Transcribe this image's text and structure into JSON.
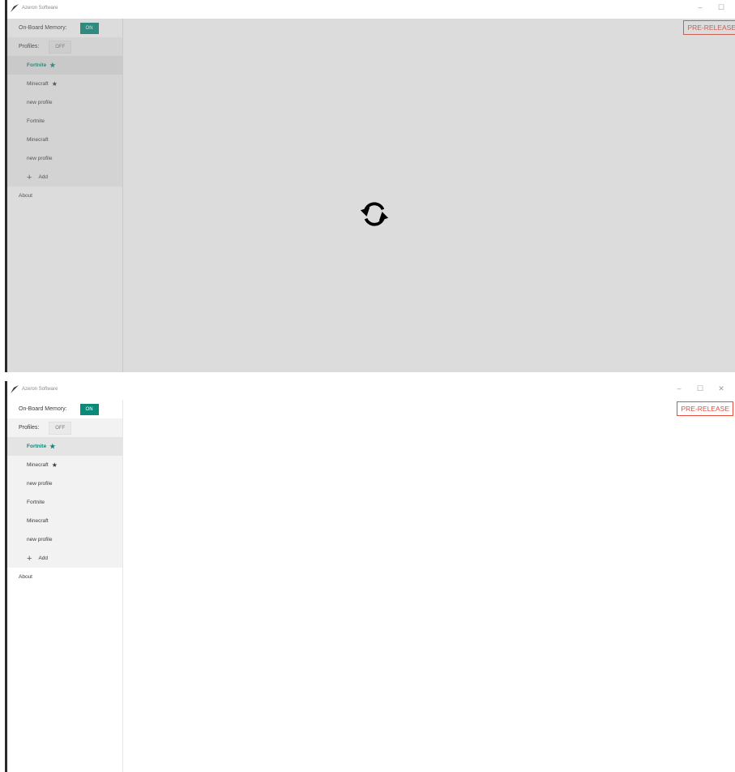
{
  "window_title": "Azeron Software",
  "window_controls": {
    "minimize": "–",
    "maximize": "☐",
    "close": "✕"
  },
  "sidebar": {
    "onboard_memory_label": "On-Board Memory:",
    "onboard_memory_toggle": "ON",
    "profiles_label": "Profiles:",
    "profiles_toggle": "OFF",
    "profiles": [
      {
        "name": "Fortnite",
        "star": "★",
        "active": true
      },
      {
        "name": "Minecraft",
        "star": "★",
        "active": false
      },
      {
        "name": "new profile",
        "star": "",
        "active": false
      },
      {
        "name": "Fortnite",
        "star": "",
        "active": false
      },
      {
        "name": "Minecraft",
        "star": "",
        "active": false
      },
      {
        "name": "new profile",
        "star": "",
        "active": false
      }
    ],
    "add_icon": "+",
    "add_label": "Add",
    "about_label": "About"
  },
  "badge_label": "PRE-RELEASE",
  "colors": {
    "accent": "#0b8a7a",
    "badge": "#e74c3c"
  },
  "loading": {
    "icon": "sync-icon"
  }
}
